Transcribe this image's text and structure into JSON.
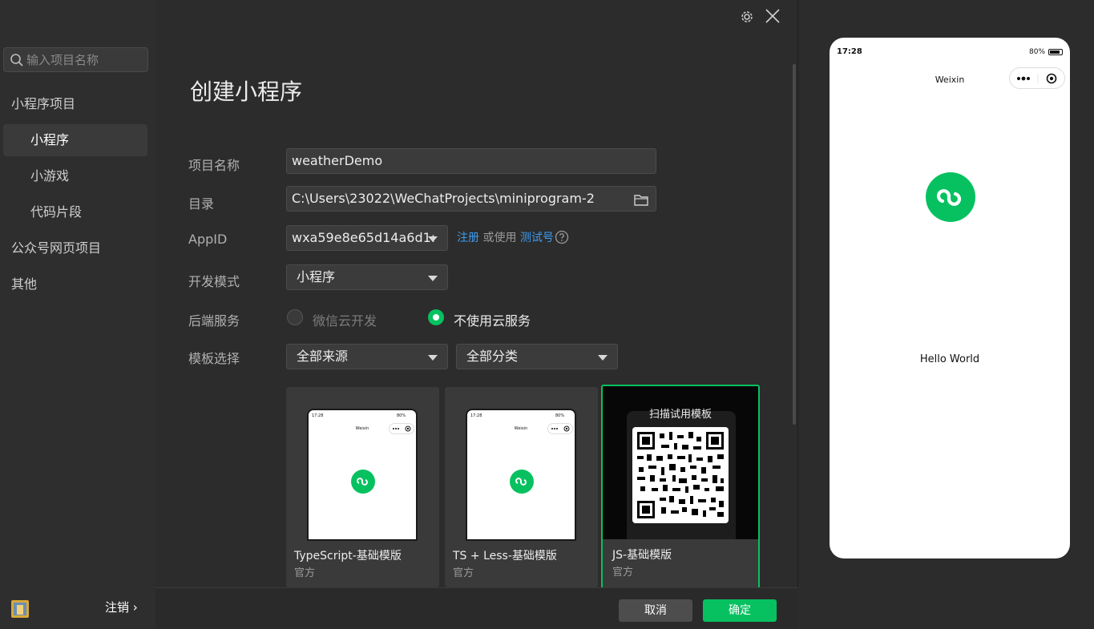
{
  "sidebar": {
    "search_placeholder": "输入项目名称",
    "items": [
      {
        "label": "小程序项目"
      },
      {
        "label": "小程序"
      },
      {
        "label": "小游戏"
      },
      {
        "label": "代码片段"
      },
      {
        "label": "公众号网页项目"
      },
      {
        "label": "其他"
      }
    ],
    "logout_label": "注销 ›"
  },
  "main": {
    "title": "创建小程序",
    "project_name": {
      "label": "项目名称",
      "value": "weatherDemo"
    },
    "directory": {
      "label": "目录",
      "value": "C:\\Users\\23022\\WeChatProjects\\miniprogram-2"
    },
    "appid": {
      "label": "AppID",
      "value": "wxa59e8e65d14a6d1:",
      "register": "注册",
      "or_use": "或使用",
      "test_account": "测试号"
    },
    "dev_mode": {
      "label": "开发模式",
      "value": "小程序"
    },
    "backend": {
      "label": "后端服务",
      "option_cloud": "微信云开发",
      "option_none": "不使用云服务",
      "selected": "不使用云服务"
    },
    "template": {
      "label": "模板选择",
      "source": "全部来源",
      "category": "全部分类"
    },
    "templates": [
      {
        "name": "TypeScript-基础模版",
        "sub": "官方"
      },
      {
        "name": "TS + Less-基础模版",
        "sub": "官方"
      },
      {
        "name": "JS-基础模版",
        "sub": "官方",
        "overlay": "扫描试用模板"
      }
    ],
    "thumb": {
      "time": "17:28",
      "battery": "80%",
      "title": "Weixin"
    },
    "cancel_label": "取消",
    "ok_label": "确定"
  },
  "preview": {
    "time": "17:28",
    "battery": "80%",
    "nav_title": "Weixin",
    "hello": "Hello World"
  },
  "colors": {
    "accent": "#07c160",
    "link": "#3d9cf0"
  }
}
